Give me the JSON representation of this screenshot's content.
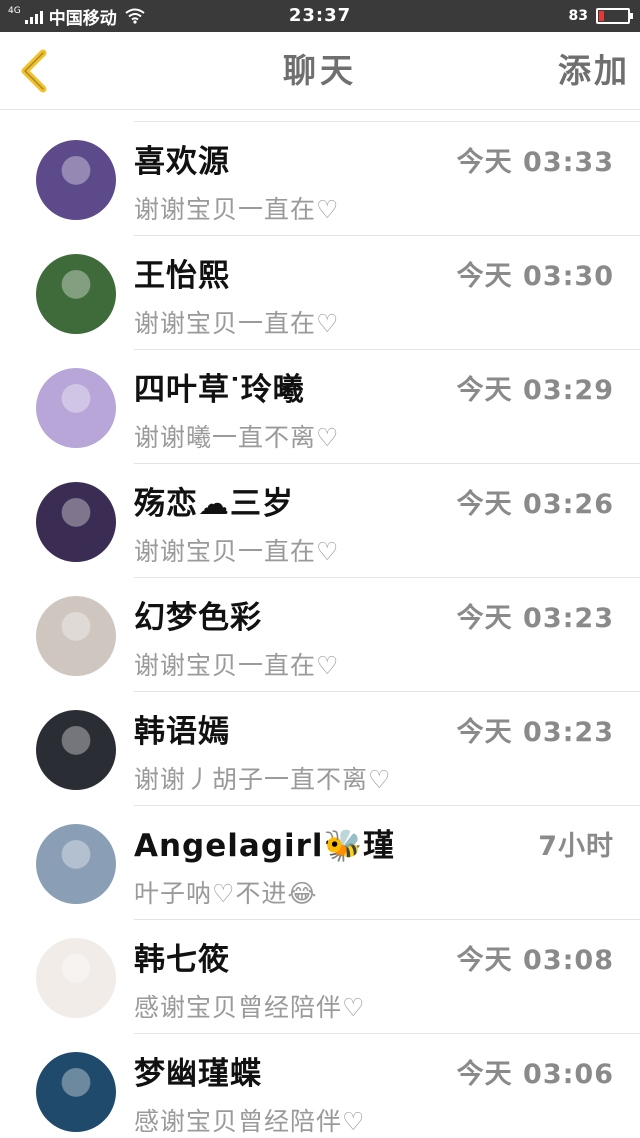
{
  "status_bar": {
    "network": "4G",
    "carrier": "中国移动",
    "time": "23:37",
    "battery_label": "83",
    "battery_level": 0.15,
    "battery_color": "#e53935"
  },
  "header": {
    "back_icon": "chevron-left-icon",
    "back_color": "#f2c12e",
    "title": "聊天",
    "add_label": "添加"
  },
  "chats": [
    {
      "name": "喜欢源",
      "time": "今天 03:33",
      "message": "谢谢宝贝一直在♡",
      "avatar_color": "#5c4a8a"
    },
    {
      "name": "王怡熙",
      "time": "今天 03:30",
      "message": "谢谢宝贝一直在♡",
      "avatar_color": "#3f6b3a"
    },
    {
      "name": "四叶草ᐝ玲曦",
      "time": "今天 03:29",
      "message": "谢谢曦一直不离♡",
      "avatar_color": "#b9a6d8"
    },
    {
      "name": "殇恋☁三岁",
      "time": "今天 03:26",
      "message": "谢谢宝贝一直在♡",
      "avatar_color": "#3a2c52"
    },
    {
      "name": "幻梦色彩",
      "time": "今天 03:23",
      "message": "谢谢宝贝一直在♡",
      "avatar_color": "#cfc6c0"
    },
    {
      "name": "韩语嫣",
      "time": "今天 03:23",
      "message": "谢谢丿胡子一直不离♡",
      "avatar_color": "#2b2d34"
    },
    {
      "name": "Angelagirl🐝瑾",
      "time": "7小时",
      "message": "叶子呐♡不进😂",
      "avatar_color": "#8a9fb5"
    },
    {
      "name": "韩七筱",
      "time": "今天 03:08",
      "message": "感谢宝贝曾经陪伴♡",
      "avatar_color": "#f1ece8"
    },
    {
      "name": "梦幽瑾蝶",
      "time": "今天 03:06",
      "message": "感谢宝贝曾经陪伴♡",
      "avatar_color": "#1f4a6b"
    }
  ]
}
